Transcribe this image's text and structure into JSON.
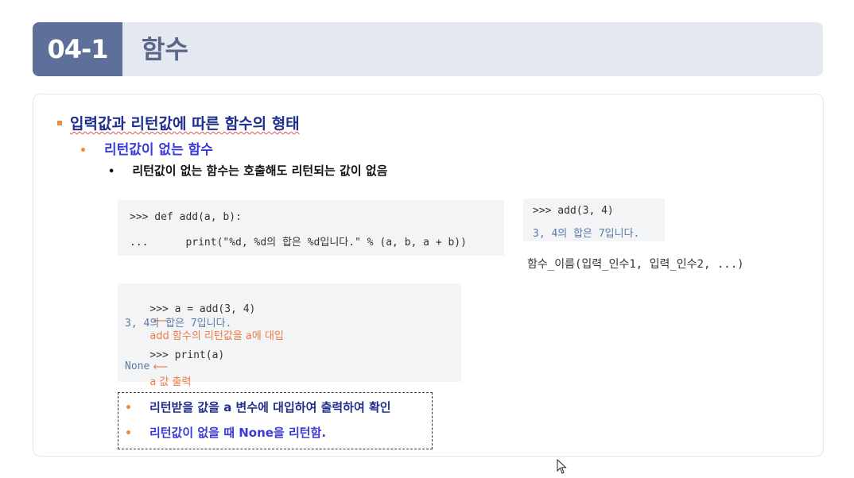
{
  "header": {
    "section_number": "04-1",
    "section_title": "함수"
  },
  "content": {
    "bullet1": "입력값과 리턴값에 따른 함수의 형태",
    "bullet2": "리턴값이 없는 함수",
    "bullet3": "리턴값이 없는 함수는 호출해도 리턴되는 값이 없음"
  },
  "code_box1": {
    "line1": ">>> def add(a, b):",
    "line2": "...      print(\"%d, %d의 합은 %d입니다.\" % (a, b, a + b))"
  },
  "code_box2": {
    "line1": ">>> add(3, 4)",
    "line2": "3, 4의 합은 7입니다."
  },
  "signature": "함수_이름(입력_인수1, 입력_인수2, ...)",
  "code_box3": {
    "line1": ">>> a = add(3, 4)",
    "note1": "add 함수의 리턴값을 a에 대입",
    "line2": "3, 4의 합은 7입니다.",
    "line3": ">>> print(a)",
    "note3": "a 값 출력",
    "line4": "None"
  },
  "notes": {
    "item1": "리턴받을 값을 a 변수에 대입하여 출력하여 확인",
    "item2": "리턴값이 없을 때 None을 리턴함."
  },
  "colors": {
    "section_number_bg": "#5e7099",
    "header_bg": "#e4e8f1",
    "accent_orange": "#ef8a3a",
    "heading_navy": "#1f2f8c",
    "heading_blue": "#3a3ad8"
  }
}
